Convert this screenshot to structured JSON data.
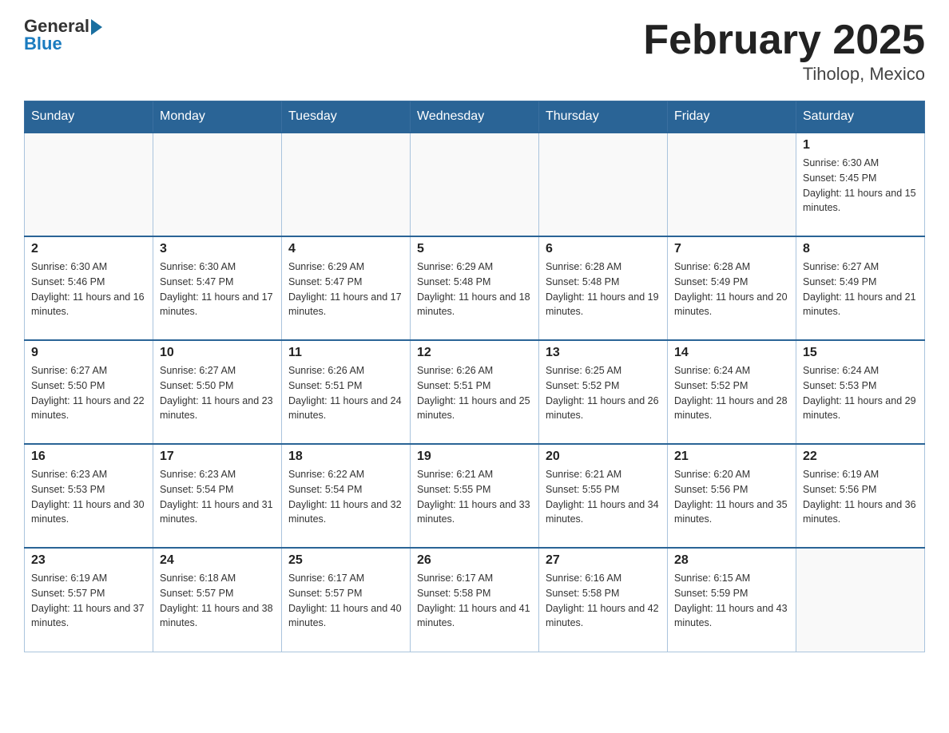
{
  "header": {
    "logo_general": "General",
    "logo_blue": "Blue",
    "month_title": "February 2025",
    "location": "Tiholop, Mexico"
  },
  "weekdays": [
    "Sunday",
    "Monday",
    "Tuesday",
    "Wednesday",
    "Thursday",
    "Friday",
    "Saturday"
  ],
  "weeks": [
    [
      {
        "day": "",
        "sunrise": "",
        "sunset": "",
        "daylight": ""
      },
      {
        "day": "",
        "sunrise": "",
        "sunset": "",
        "daylight": ""
      },
      {
        "day": "",
        "sunrise": "",
        "sunset": "",
        "daylight": ""
      },
      {
        "day": "",
        "sunrise": "",
        "sunset": "",
        "daylight": ""
      },
      {
        "day": "",
        "sunrise": "",
        "sunset": "",
        "daylight": ""
      },
      {
        "day": "",
        "sunrise": "",
        "sunset": "",
        "daylight": ""
      },
      {
        "day": "1",
        "sunrise": "Sunrise: 6:30 AM",
        "sunset": "Sunset: 5:45 PM",
        "daylight": "Daylight: 11 hours and 15 minutes."
      }
    ],
    [
      {
        "day": "2",
        "sunrise": "Sunrise: 6:30 AM",
        "sunset": "Sunset: 5:46 PM",
        "daylight": "Daylight: 11 hours and 16 minutes."
      },
      {
        "day": "3",
        "sunrise": "Sunrise: 6:30 AM",
        "sunset": "Sunset: 5:47 PM",
        "daylight": "Daylight: 11 hours and 17 minutes."
      },
      {
        "day": "4",
        "sunrise": "Sunrise: 6:29 AM",
        "sunset": "Sunset: 5:47 PM",
        "daylight": "Daylight: 11 hours and 17 minutes."
      },
      {
        "day": "5",
        "sunrise": "Sunrise: 6:29 AM",
        "sunset": "Sunset: 5:48 PM",
        "daylight": "Daylight: 11 hours and 18 minutes."
      },
      {
        "day": "6",
        "sunrise": "Sunrise: 6:28 AM",
        "sunset": "Sunset: 5:48 PM",
        "daylight": "Daylight: 11 hours and 19 minutes."
      },
      {
        "day": "7",
        "sunrise": "Sunrise: 6:28 AM",
        "sunset": "Sunset: 5:49 PM",
        "daylight": "Daylight: 11 hours and 20 minutes."
      },
      {
        "day": "8",
        "sunrise": "Sunrise: 6:27 AM",
        "sunset": "Sunset: 5:49 PM",
        "daylight": "Daylight: 11 hours and 21 minutes."
      }
    ],
    [
      {
        "day": "9",
        "sunrise": "Sunrise: 6:27 AM",
        "sunset": "Sunset: 5:50 PM",
        "daylight": "Daylight: 11 hours and 22 minutes."
      },
      {
        "day": "10",
        "sunrise": "Sunrise: 6:27 AM",
        "sunset": "Sunset: 5:50 PM",
        "daylight": "Daylight: 11 hours and 23 minutes."
      },
      {
        "day": "11",
        "sunrise": "Sunrise: 6:26 AM",
        "sunset": "Sunset: 5:51 PM",
        "daylight": "Daylight: 11 hours and 24 minutes."
      },
      {
        "day": "12",
        "sunrise": "Sunrise: 6:26 AM",
        "sunset": "Sunset: 5:51 PM",
        "daylight": "Daylight: 11 hours and 25 minutes."
      },
      {
        "day": "13",
        "sunrise": "Sunrise: 6:25 AM",
        "sunset": "Sunset: 5:52 PM",
        "daylight": "Daylight: 11 hours and 26 minutes."
      },
      {
        "day": "14",
        "sunrise": "Sunrise: 6:24 AM",
        "sunset": "Sunset: 5:52 PM",
        "daylight": "Daylight: 11 hours and 28 minutes."
      },
      {
        "day": "15",
        "sunrise": "Sunrise: 6:24 AM",
        "sunset": "Sunset: 5:53 PM",
        "daylight": "Daylight: 11 hours and 29 minutes."
      }
    ],
    [
      {
        "day": "16",
        "sunrise": "Sunrise: 6:23 AM",
        "sunset": "Sunset: 5:53 PM",
        "daylight": "Daylight: 11 hours and 30 minutes."
      },
      {
        "day": "17",
        "sunrise": "Sunrise: 6:23 AM",
        "sunset": "Sunset: 5:54 PM",
        "daylight": "Daylight: 11 hours and 31 minutes."
      },
      {
        "day": "18",
        "sunrise": "Sunrise: 6:22 AM",
        "sunset": "Sunset: 5:54 PM",
        "daylight": "Daylight: 11 hours and 32 minutes."
      },
      {
        "day": "19",
        "sunrise": "Sunrise: 6:21 AM",
        "sunset": "Sunset: 5:55 PM",
        "daylight": "Daylight: 11 hours and 33 minutes."
      },
      {
        "day": "20",
        "sunrise": "Sunrise: 6:21 AM",
        "sunset": "Sunset: 5:55 PM",
        "daylight": "Daylight: 11 hours and 34 minutes."
      },
      {
        "day": "21",
        "sunrise": "Sunrise: 6:20 AM",
        "sunset": "Sunset: 5:56 PM",
        "daylight": "Daylight: 11 hours and 35 minutes."
      },
      {
        "day": "22",
        "sunrise": "Sunrise: 6:19 AM",
        "sunset": "Sunset: 5:56 PM",
        "daylight": "Daylight: 11 hours and 36 minutes."
      }
    ],
    [
      {
        "day": "23",
        "sunrise": "Sunrise: 6:19 AM",
        "sunset": "Sunset: 5:57 PM",
        "daylight": "Daylight: 11 hours and 37 minutes."
      },
      {
        "day": "24",
        "sunrise": "Sunrise: 6:18 AM",
        "sunset": "Sunset: 5:57 PM",
        "daylight": "Daylight: 11 hours and 38 minutes."
      },
      {
        "day": "25",
        "sunrise": "Sunrise: 6:17 AM",
        "sunset": "Sunset: 5:57 PM",
        "daylight": "Daylight: 11 hours and 40 minutes."
      },
      {
        "day": "26",
        "sunrise": "Sunrise: 6:17 AM",
        "sunset": "Sunset: 5:58 PM",
        "daylight": "Daylight: 11 hours and 41 minutes."
      },
      {
        "day": "27",
        "sunrise": "Sunrise: 6:16 AM",
        "sunset": "Sunset: 5:58 PM",
        "daylight": "Daylight: 11 hours and 42 minutes."
      },
      {
        "day": "28",
        "sunrise": "Sunrise: 6:15 AM",
        "sunset": "Sunset: 5:59 PM",
        "daylight": "Daylight: 11 hours and 43 minutes."
      },
      {
        "day": "",
        "sunrise": "",
        "sunset": "",
        "daylight": ""
      }
    ]
  ]
}
